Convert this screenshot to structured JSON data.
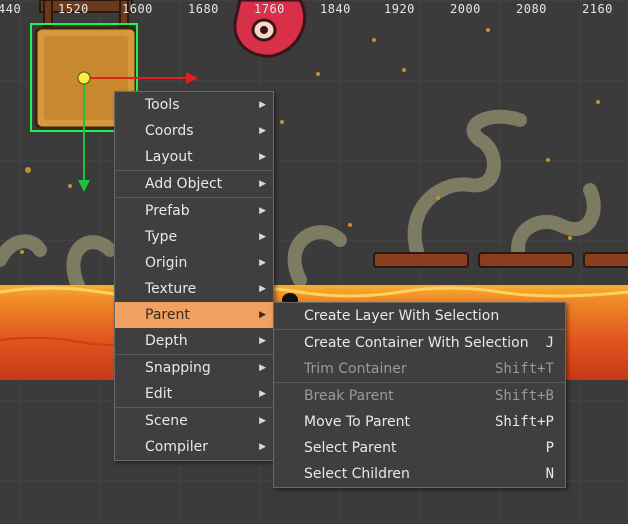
{
  "ruler": [
    "440",
    "1520",
    "1600",
    "1680",
    "1760",
    "1840",
    "1920",
    "2000",
    "2080",
    "2160"
  ],
  "context_menu": {
    "items": [
      {
        "label": "Tools"
      },
      {
        "label": "Coords"
      },
      {
        "label": "Layout"
      },
      {
        "label": "Add Object"
      },
      {
        "label": "Prefab"
      },
      {
        "label": "Type"
      },
      {
        "label": "Origin"
      },
      {
        "label": "Texture"
      },
      {
        "label": "Parent"
      },
      {
        "label": "Depth"
      },
      {
        "label": "Snapping"
      },
      {
        "label": "Edit"
      },
      {
        "label": "Scene"
      },
      {
        "label": "Compiler"
      }
    ],
    "active": "Parent"
  },
  "submenu": {
    "items": [
      {
        "label": "Create Layer With Selection",
        "shortcut": ""
      },
      {
        "label": "Create Container With Selection",
        "shortcut": "J"
      },
      {
        "label": "Trim Container",
        "shortcut": "Shift+T"
      },
      {
        "label": "Break Parent",
        "shortcut": "Shift+B"
      },
      {
        "label": "Move To Parent",
        "shortcut": "Shift+P"
      },
      {
        "label": "Select Parent",
        "shortcut": "P"
      },
      {
        "label": "Select Children",
        "shortcut": "N"
      }
    ]
  },
  "colors": {
    "menu_bg": "#3f3f3f",
    "highlight": "#f0a060",
    "lava": "#e8652a",
    "selection": "#22ee55",
    "gizmo_x": "#e02020",
    "gizmo_y": "#20c040"
  }
}
